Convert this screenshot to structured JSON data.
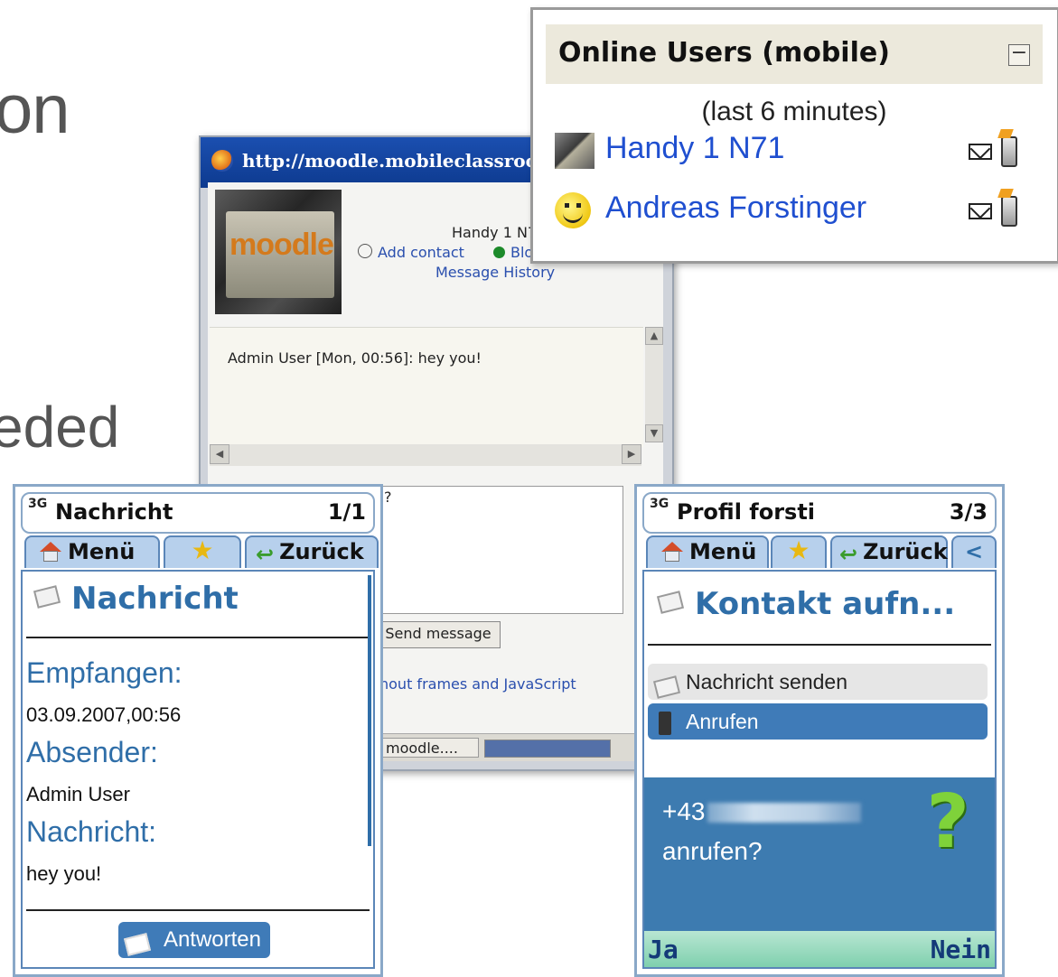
{
  "background": {
    "text_top": "on",
    "text_mid": "eded"
  },
  "browser": {
    "url": "http://moodle.mobileclassroom.a",
    "header": {
      "user_name": "Handy 1 N7",
      "add_contact": "Add contact",
      "block": "Blo",
      "history": "Message History"
    },
    "message_line": "Admin User [Mon, 00:56]: hey you!",
    "compose_fragment": "?",
    "send_button": "Send message",
    "noframes_link": "hout frames and JavaScript",
    "taskbar_item": "moodle...."
  },
  "online_users": {
    "title": "Online Users (mobile)",
    "collapse": "−",
    "since": "(last 6 minutes)",
    "users": [
      {
        "name": "Handy 1 N71",
        "avatar": "screen-photo"
      },
      {
        "name": "Andreas Forstinger",
        "avatar": "smiley"
      }
    ]
  },
  "phone_left": {
    "net": "3G",
    "title": "Nachricht",
    "page": "1/1",
    "tabs": {
      "menu": "Menü",
      "back": "Zurück"
    },
    "heading": "Nachricht",
    "received_label": "Empfangen:",
    "received_value": "03.09.2007,00:56",
    "sender_label": "Absender:",
    "sender_value": "Admin User",
    "message_label": "Nachricht:",
    "message_value": "hey you!",
    "reply_button": "Antworten"
  },
  "phone_right": {
    "net": "3G",
    "title": "Profil forsti",
    "page": "3/3",
    "tabs": {
      "menu": "Menü",
      "back": "Zurück",
      "more": "<"
    },
    "heading": "Kontakt aufn...",
    "options": [
      "Nachricht senden",
      "Anrufen"
    ],
    "dialog": {
      "number": "+43",
      "question": "anrufen?",
      "icon": "?"
    },
    "softkeys": {
      "left": "Ja",
      "right": "Nein"
    }
  },
  "colors": {
    "link": "#1f4fd0",
    "phone_accent": "#3f7bb8",
    "title_blue": "#2f6ea8"
  }
}
